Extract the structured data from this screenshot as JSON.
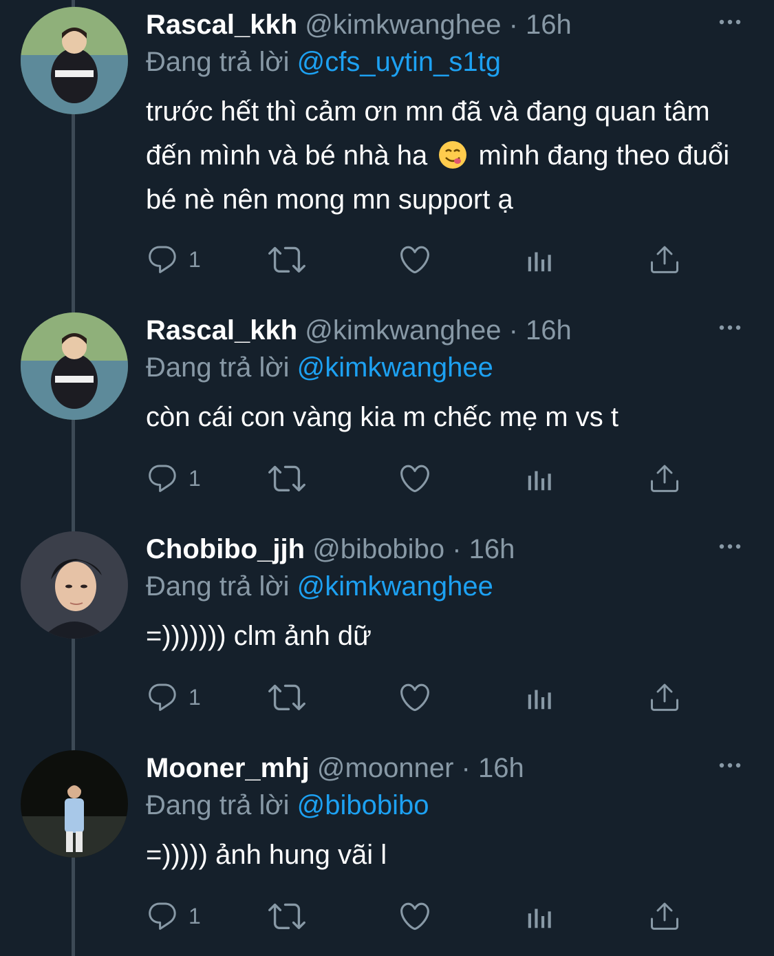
{
  "tweets": [
    {
      "name": "Rascal_kkh",
      "handle": "@kimkwanghee",
      "dot": "·",
      "time": "16h",
      "reply_prefix": "Đang trả lời",
      "reply_to": "@cfs_uytin_s1tg",
      "body_parts": [
        "trước hết thì cảm ơn mn đã và đang quan tâm đến mình và bé nhà ha",
        "mình đang theo đuổi bé nè nên mong mn support ạ"
      ],
      "reply_count": "1"
    },
    {
      "name": "Rascal_kkh",
      "handle": "@kimkwanghee",
      "dot": "·",
      "time": "16h",
      "reply_prefix": "Đang trả lời",
      "reply_to": "@kimkwanghee",
      "body": "còn cái con vàng kia m chếc mẹ m vs t",
      "reply_count": "1"
    },
    {
      "name": "Chobibo_jjh",
      "handle": "@bibobibo",
      "dot": "·",
      "time": "16h",
      "reply_prefix": "Đang trả lời",
      "reply_to": "@kimkwanghee",
      "body": "=))))))) clm ảnh dữ",
      "reply_count": "1"
    },
    {
      "name": "Mooner_mhj",
      "handle": "@moonner",
      "dot": "·",
      "time": "16h",
      "reply_prefix": "Đang trả lời",
      "reply_to": "@bibobibo",
      "body": "=))))) ảnh hung vãi l",
      "reply_count": "1"
    }
  ],
  "icons": {
    "reply": "reply-icon",
    "retweet": "retweet-icon",
    "like": "heart-icon",
    "views": "analytics-icon",
    "share": "share-icon",
    "more": "more-icon",
    "emoji": "yum-face-emoji"
  },
  "colors": {
    "background": "#15202b",
    "text": "#ffffff",
    "muted": "#8899a6",
    "link": "#1da1f2",
    "thread_line": "#3d4a56"
  }
}
